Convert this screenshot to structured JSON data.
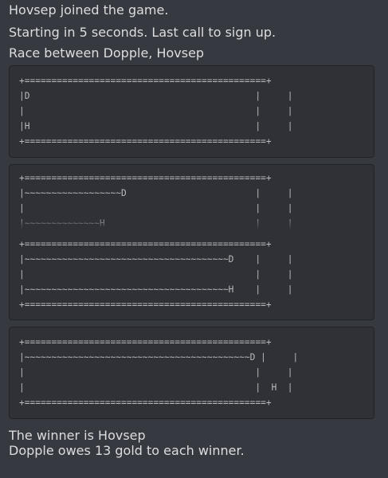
{
  "messages": {
    "joined": "Hovsep joined the game.",
    "countdown": "Starting in 5 seconds. Last call to sign up.",
    "race_between": "Race between Dopple, Hovsep",
    "winner": "The winner is Hovsep",
    "owes": "Dopple owes 13 gold to each winner."
  },
  "race_frames": {
    "start": "+=============================================+\n|D                                          |     |\n|                                           |     |\n|H                                          |     |\n+=============================================+",
    "mid_top": "+=============================================+\n|~~~~~~~~~~~~~~~~~~D                        |     |\n|                                           |     |\n|~~~~~~~~~~~~~~H                            |     |",
    "mid_bottom": "+=============================================+\n|~~~~~~~~~~~~~~~~~~~~~~~~~~~~~~~~~~~~~~D    |     |\n|                                           |     |\n|~~~~~~~~~~~~~~~~~~~~~~~~~~~~~~~~~~~~~~H    |     |\n+=============================================+",
    "final": "+=============================================+\n|~~~~~~~~~~~~~~~~~~~~~~~~~~~~~~~~~~~~~~~~~~D |     |\n|                                           |     |\n|                                           |  H  |\n+=============================================+"
  },
  "colors": {
    "background": "#36393f",
    "codeblock": "#2f3136",
    "text": "#dcddde"
  }
}
